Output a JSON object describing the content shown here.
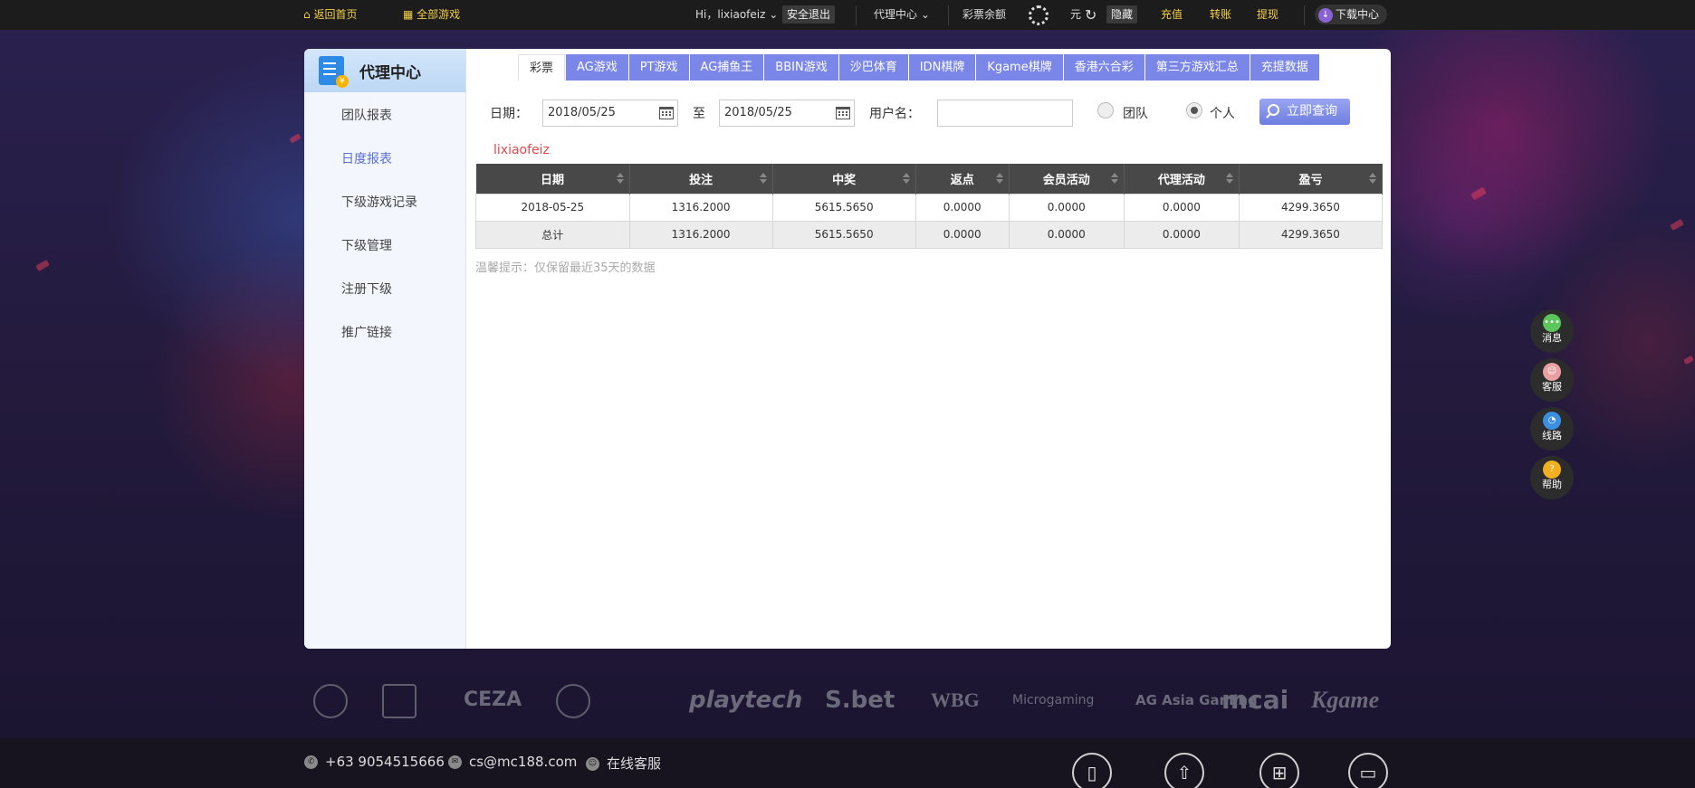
{
  "topbar": {
    "home_label": "返回首页",
    "all_games_label": "全部游戏",
    "greeting": "Hi，lixiaofeiz",
    "logout_label": "安全退出",
    "agent_center_label": "代理中心",
    "balance_label": "彩票余额",
    "currency_label": "元",
    "hide_label": "隐藏",
    "recharge_label": "充值",
    "transfer_label": "转账",
    "withdraw_label": "提现",
    "download_label": "下载中心"
  },
  "sidebar": {
    "title": "代理中心",
    "items": [
      "团队报表",
      "日度报表",
      "下级游戏记录",
      "下级管理",
      "注册下级",
      "推广链接"
    ],
    "active_index": 1
  },
  "tabs": [
    "彩票",
    "AG游戏",
    "PT游戏",
    "AG捕鱼王",
    "BBIN游戏",
    "沙巴体育",
    "IDN棋牌",
    "Kgame棋牌",
    "香港六合彩",
    "第三方游戏汇总",
    "充提数据"
  ],
  "filters": {
    "date_label": "日期：",
    "date_from": "2018/05/25",
    "to_label": "至",
    "date_to": "2018/05/25",
    "username_label": "用户名：",
    "username_value": "",
    "team_label": "团队",
    "personal_label": "个人",
    "selected": "personal",
    "search_label": "立即查询"
  },
  "report": {
    "username": "lixiaofeiz",
    "columns": [
      "日期",
      "投注",
      "中奖",
      "返点",
      "会员活动",
      "代理活动",
      "盈亏"
    ],
    "rows": [
      [
        "2018-05-25",
        "1316.2000",
        "5615.5650",
        "0.0000",
        "0.0000",
        "0.0000",
        "4299.3650"
      ]
    ],
    "total": [
      "总计",
      "1316.2000",
      "5615.5650",
      "0.0000",
      "0.0000",
      "0.0000",
      "4299.3650"
    ],
    "tip": "温馨提示：仅保留最近35天的数据"
  },
  "float_buttons": [
    {
      "label": "消息",
      "icon": "message-icon",
      "color": "#5cc65c",
      "glyph": "•••"
    },
    {
      "label": "客服",
      "icon": "service-icon",
      "color": "#e8a0a0",
      "glyph": "☺"
    },
    {
      "label": "线路",
      "icon": "route-icon",
      "color": "#3c8fe0",
      "glyph": "◔"
    },
    {
      "label": "帮助",
      "icon": "help-icon",
      "color": "#f0b020",
      "glyph": "?"
    }
  ],
  "partner_logos": [
    "CEZA",
    "playtech",
    "S.bet",
    "WBG",
    "Microgaming",
    "AG Asia Gaming",
    "mcai",
    "Kgame"
  ],
  "footer": {
    "phone": "+63 9054515666",
    "email": "cs@mc188.com",
    "online_service": "在线客服"
  }
}
